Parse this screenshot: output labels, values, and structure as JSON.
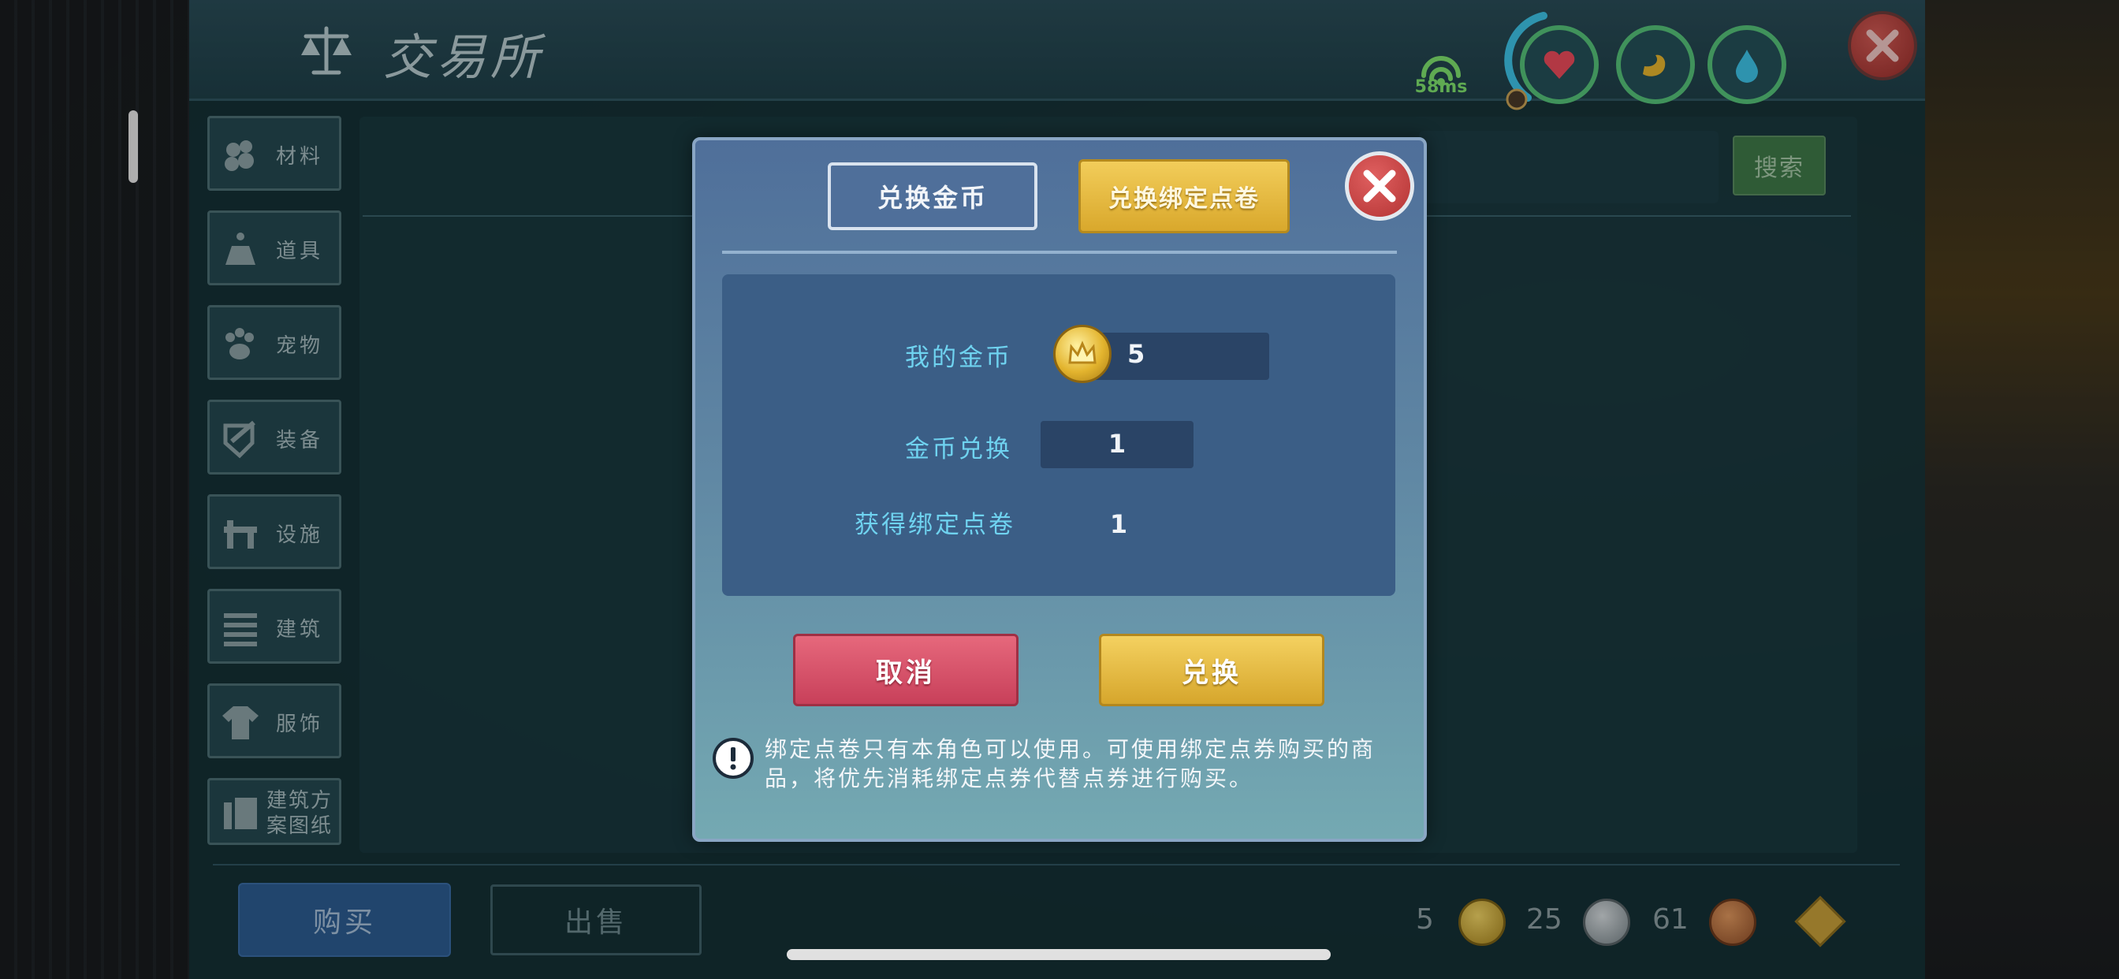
{
  "header": {
    "title": "交易所",
    "ping": "58ms"
  },
  "sidebar": {
    "items": [
      {
        "label": "材料",
        "icon": "stones-icon"
      },
      {
        "label": "道具",
        "icon": "tool-icon"
      },
      {
        "label": "宠物",
        "icon": "paw-icon"
      },
      {
        "label": "装备",
        "icon": "armor-icon"
      },
      {
        "label": "设施",
        "icon": "facility-icon"
      },
      {
        "label": "建筑",
        "icon": "building-icon"
      },
      {
        "label": "服饰",
        "icon": "clothing-icon"
      },
      {
        "label": "建筑方案图纸",
        "icon": "blueprint-icon"
      }
    ]
  },
  "search": {
    "button_label": "搜索"
  },
  "footer": {
    "buy_label": "购买",
    "sell_label": "出售",
    "currencies": {
      "gold": "5",
      "silver": "25",
      "bronze": "61"
    }
  },
  "modal": {
    "tab_gold": "兑换金币",
    "tab_points": "兑换绑定点卷",
    "my_gold_label": "我的金币",
    "my_gold_value": "5",
    "exchange_label": "金币兑换",
    "exchange_value": "1",
    "receive_label": "获得绑定点卷",
    "receive_value": "1",
    "cancel_label": "取消",
    "confirm_label": "兑换",
    "note": "绑定点卷只有本角色可以使用。可使用绑定点券购买的商品，将优先消耗绑定点券代替点券进行购买。"
  },
  "colors": {
    "accent_gold": "#d9a82c",
    "cancel_red": "#c8405a",
    "label_cyan": "#6fd3f0",
    "ping_green": "#7fe36e"
  }
}
